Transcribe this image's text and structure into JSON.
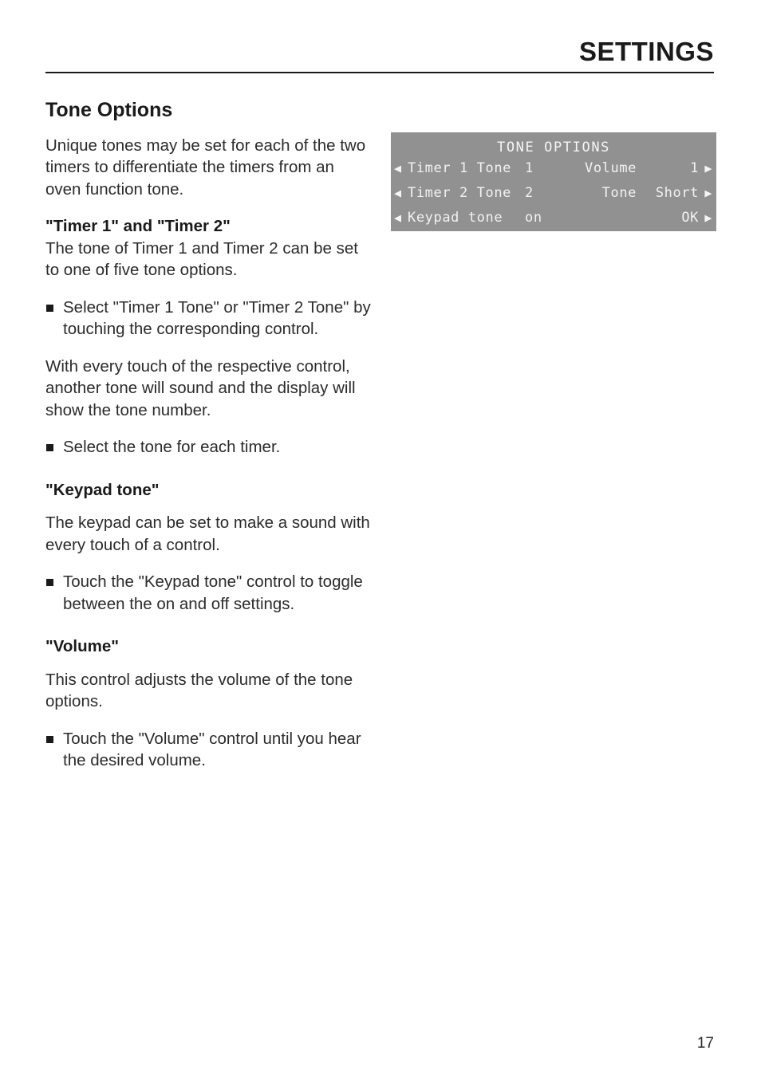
{
  "header": {
    "title": "SETTINGS"
  },
  "section": {
    "title": "Tone Options",
    "intro": "Unique tones may be set for each of the two timers to differentiate the timers from an oven function tone."
  },
  "timers": {
    "heading": "\"Timer 1\" and \"Timer 2\"",
    "body": "The tone of Timer 1 and Timer 2 can be set to one of five tone options.",
    "bullet_1": "Select \"Timer 1 Tone\" or \"Timer 2 Tone\" by touching the corresponding control.",
    "body_2": "With every touch of the respective control, another tone will sound and the display will show the tone number.",
    "bullet_2": "Select the tone for each timer."
  },
  "keypad": {
    "heading": "\"Keypad tone\"",
    "body": "The keypad can be set to make a sound with every touch of a control.",
    "bullet": "Touch the \"Keypad tone\" control to toggle between the on and off settings."
  },
  "volume": {
    "heading": "\"Volume\"",
    "body": "This control adjusts the volume of the tone options.",
    "bullet": "Touch the \"Volume\" control until you hear the desired volume."
  },
  "lcd": {
    "title": "TONE OPTIONS",
    "background_color": "#919191",
    "text_color": "#f2f2f2",
    "arrow_left_icon": "◀",
    "arrow_right_icon": "▶",
    "rows": [
      {
        "left_label": "Timer 1 Tone",
        "left_value": "1",
        "right_label": "Volume",
        "right_value": "1"
      },
      {
        "left_label": "Timer 2 Tone",
        "left_value": "2",
        "right_label": "Tone",
        "right_value": "Short"
      },
      {
        "left_label": "Keypad tone",
        "left_value": "on",
        "right_label": "",
        "right_value": "OK"
      }
    ]
  },
  "footer": {
    "page_number": "17"
  }
}
